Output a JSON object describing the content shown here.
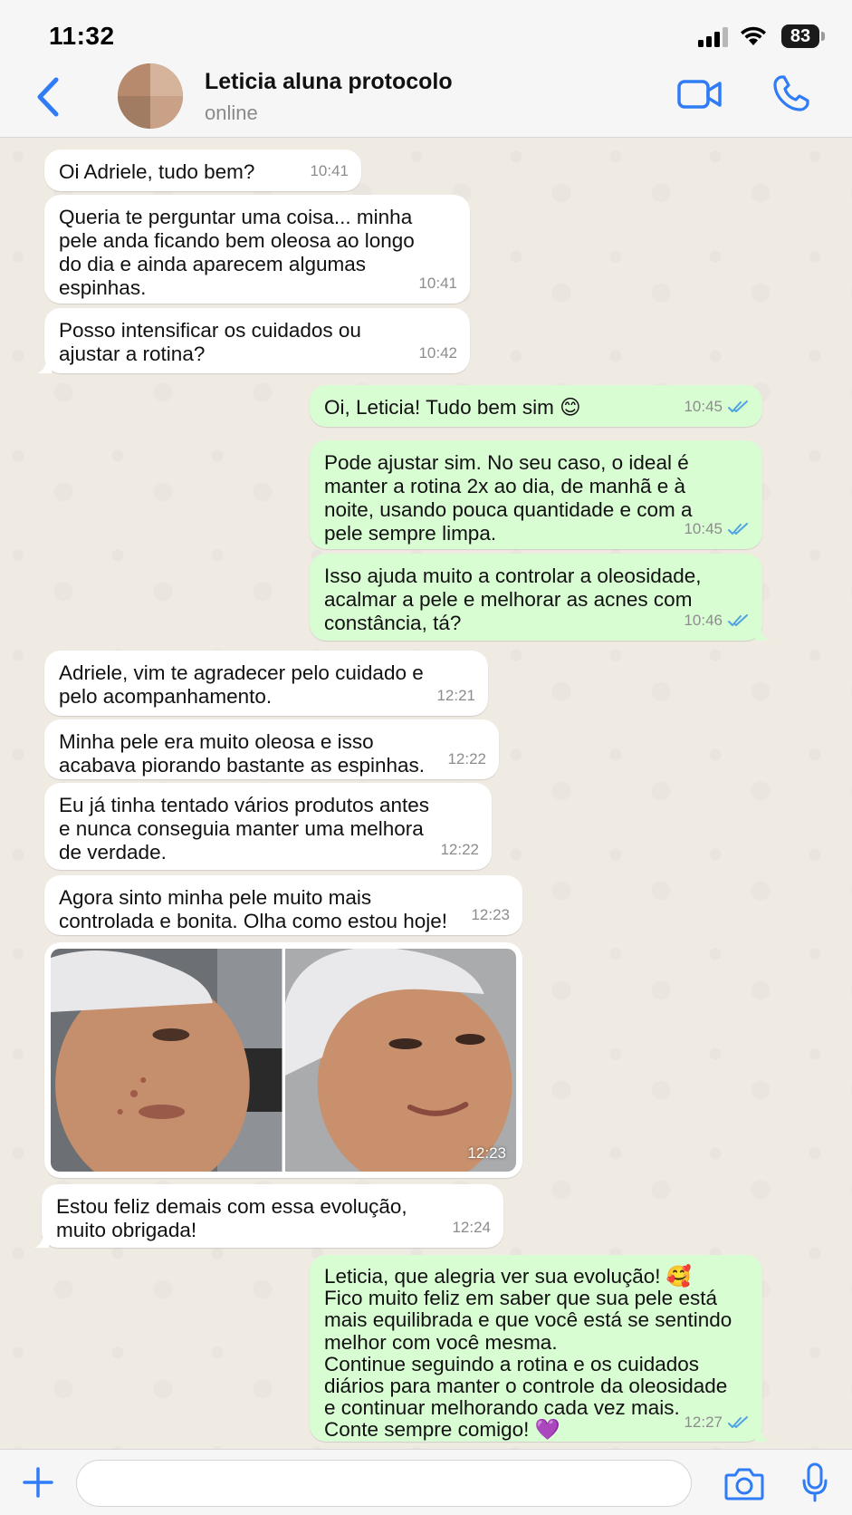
{
  "status_bar": {
    "time": "11:32",
    "battery": "83"
  },
  "header": {
    "contact_name": "Leticia aluna protocolo",
    "contact_status": "online"
  },
  "messages": [
    {
      "direction": "in",
      "text": "Oi Adriele, tudo bem?",
      "time": "10:41"
    },
    {
      "direction": "in",
      "text": "Queria te perguntar uma coisa... minha\npele anda ficando bem oleosa ao longo\ndo dia e ainda aparecem algumas\nespinhas.",
      "time": "10:41"
    },
    {
      "direction": "in",
      "text": "Posso intensificar os cuidados ou\najustar a rotina?",
      "time": "10:42"
    },
    {
      "direction": "out",
      "text": "Oi, Leticia! Tudo bem sim 😊",
      "time": "10:45",
      "read": true
    },
    {
      "direction": "out",
      "text": "Pode ajustar sim. No seu caso, o ideal é\nmanter a rotina 2x ao dia, de manhã e à\nnoite, usando pouca quantidade e com a\npele sempre limpa.",
      "time": "10:45",
      "read": true
    },
    {
      "direction": "out",
      "text": "Isso ajuda muito a controlar a oleosidade,\nacalmar a pele e melhorar as acnes com\nconstância, tá?",
      "time": "10:46",
      "read": true
    },
    {
      "direction": "in",
      "text": "Adriele, vim te agradecer pelo cuidado e\npelo acompanhamento.",
      "time": "12:21"
    },
    {
      "direction": "in",
      "text": "Minha pele era muito oleosa e isso\nacabava piorando bastante as espinhas.",
      "time": "12:22"
    },
    {
      "direction": "in",
      "text": "Eu já tinha tentado vários produtos antes\ne nunca conseguia manter uma melhora\nde verdade.",
      "time": "12:22"
    },
    {
      "direction": "in",
      "text": "Agora sinto minha pele muito mais\ncontrolada e bonita. Olha como estou hoje!",
      "time": "12:23"
    },
    {
      "direction": "in",
      "type": "image",
      "time": "12:23"
    },
    {
      "direction": "in",
      "text": "Estou feliz demais com essa evolução,\nmuito obrigada!",
      "time": "12:24"
    },
    {
      "direction": "out",
      "text": "Leticia, que alegria ver sua evolução! 🥰\nFico muito feliz em saber que sua pele está\nmais equilibrada e que você está se sentindo\nmelhor com você mesma.\nContinue seguindo a rotina e os cuidados\ndiários para manter o controle da oleosidade\ne continuar melhorando cada vez mais.\nConte sempre comigo! 💜",
      "time": "12:27",
      "read": true
    }
  ],
  "input": {
    "placeholder": ""
  },
  "colors": {
    "accent": "#2f7cf6",
    "outgoing_bubble": "#d9fdd3",
    "incoming_bubble": "#ffffff",
    "chat_background": "#efeae2",
    "read_ticks": "#4fa3e0"
  },
  "icons": {
    "back": "chevron-left-icon",
    "video": "video-camera-icon",
    "call": "phone-icon",
    "plus": "plus-icon",
    "camera": "camera-icon",
    "mic": "microphone-icon"
  }
}
